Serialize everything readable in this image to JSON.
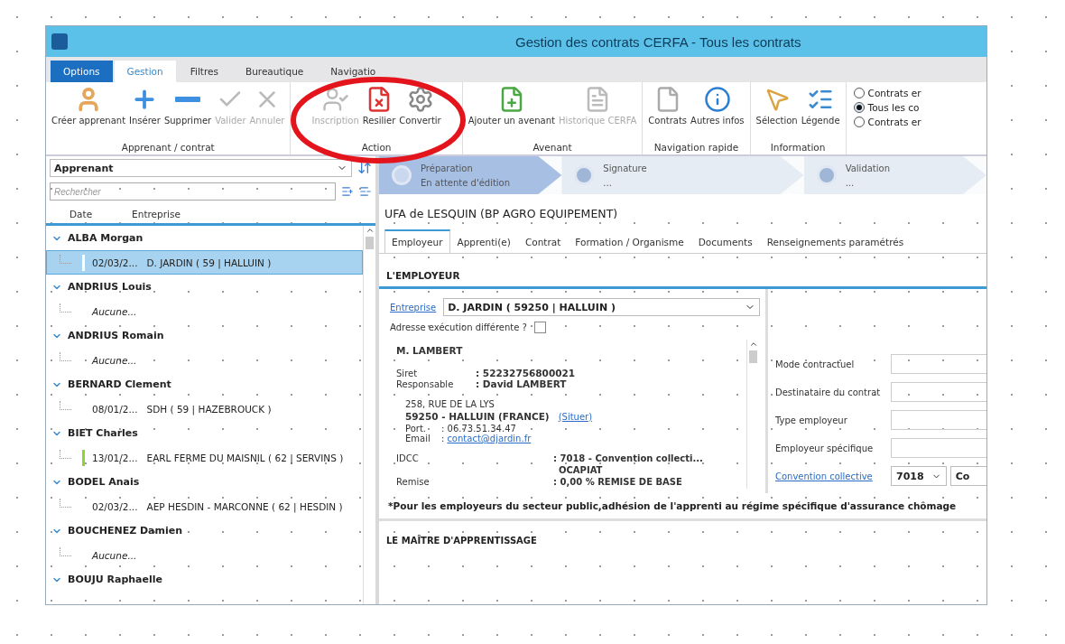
{
  "window": {
    "title": "Gestion des contrats CERFA - Tous les contrats"
  },
  "ribbon_tabs": [
    {
      "label": "Options",
      "kind": "menu",
      "selected": false
    },
    {
      "label": "Gestion",
      "kind": "tab",
      "selected": true
    },
    {
      "label": "Filtres",
      "kind": "tab",
      "selected": false
    },
    {
      "label": "Bureautique",
      "kind": "tab",
      "selected": false
    },
    {
      "label": "Navigatio",
      "kind": "tab",
      "selected": false
    }
  ],
  "ribbon": {
    "groups": [
      {
        "label": "Apprenant / contrat",
        "buttons": [
          {
            "label": "Créer apprenant",
            "disabled": false
          },
          {
            "label": "Insérer",
            "disabled": false
          },
          {
            "label": "Supprimer",
            "disabled": false
          },
          {
            "label": "Valider",
            "disabled": true
          },
          {
            "label": "Annuler",
            "disabled": true
          }
        ]
      },
      {
        "label": "Action",
        "buttons": [
          {
            "label": "Inscription",
            "disabled": true
          },
          {
            "label": "Resilier",
            "disabled": false
          },
          {
            "label": "Convertir",
            "disabled": false
          }
        ]
      },
      {
        "label": "Avenant",
        "buttons": [
          {
            "label": "Ajouter un avenant",
            "disabled": false
          },
          {
            "label": "Historique CERFA",
            "disabled": true
          }
        ]
      },
      {
        "label": "Navigation rapide",
        "buttons": [
          {
            "label": "Contrats",
            "disabled": false
          },
          {
            "label": "Autres infos",
            "disabled": false
          }
        ]
      },
      {
        "label": "Information",
        "buttons": [
          {
            "label": "Sélection",
            "disabled": false
          },
          {
            "label": "Légende",
            "disabled": false
          }
        ]
      }
    ],
    "filters": [
      {
        "label": "Contrats er",
        "selected": false
      },
      {
        "label": "Tous les co",
        "selected": true
      },
      {
        "label": "Contrats er",
        "selected": false
      }
    ]
  },
  "left_panel": {
    "group_by": "Apprenant",
    "search": {
      "placeholder": "Rechercher"
    },
    "columns": [
      "Date",
      "Entreprise"
    ],
    "groups": [
      {
        "name": "ALBA Morgan",
        "expanded": true,
        "children": [
          {
            "kind": "contract",
            "date": "02/03/2...",
            "company": "D. JARDIN ( 59 | HALLUIN )",
            "selected": true,
            "color": "#ffffff"
          }
        ]
      },
      {
        "name": "ANDRIUS Louis",
        "expanded": true,
        "children": [
          {
            "kind": "none",
            "text": "Aucune...",
            "selected": false
          }
        ]
      },
      {
        "name": "ANDRIUS Romain",
        "expanded": true,
        "children": [
          {
            "kind": "none",
            "text": "Aucune...",
            "selected": false
          }
        ]
      },
      {
        "name": "BERNARD Clement",
        "expanded": true,
        "children": [
          {
            "kind": "contract",
            "date": "08/01/2...",
            "company": "SDH ( 59 | HAZEBROUCK )",
            "selected": false
          }
        ]
      },
      {
        "name": "BIET Charles",
        "expanded": true,
        "children": [
          {
            "kind": "contract",
            "date": "13/01/2...",
            "company": "EARL FERME DU MAISNIL ( 62 | SERVINS )",
            "selected": false,
            "color": "#8fd62e"
          }
        ]
      },
      {
        "name": "BODEL Anais",
        "expanded": true,
        "children": [
          {
            "kind": "contract",
            "date": "02/03/2...",
            "company": "AEP HESDIN - MARCONNE ( 62 | HESDIN )",
            "selected": false
          }
        ]
      },
      {
        "name": "BOUCHENEZ Damien",
        "expanded": true,
        "children": [
          {
            "kind": "none",
            "text": "Aucune...",
            "selected": false
          }
        ]
      },
      {
        "name": "BOUJU Raphaelle",
        "expanded": true
      }
    ]
  },
  "steps": [
    {
      "title": "Préparation",
      "subtitle": "En attente d'édition",
      "active": true
    },
    {
      "title": "Signature",
      "subtitle": "...",
      "active": false
    },
    {
      "title": "Validation",
      "subtitle": "...",
      "active": false
    }
  ],
  "heading": "UFA de LESQUIN (BP AGRO EQUIPEMENT)",
  "detail_tabs": [
    {
      "label": "Employeur",
      "selected": true
    },
    {
      "label": "Apprenti(e)",
      "selected": false
    },
    {
      "label": "Contrat",
      "selected": false
    },
    {
      "label": "Formation / Organisme",
      "selected": false
    },
    {
      "label": "Documents",
      "selected": false
    },
    {
      "label": "Renseignements paramétrés",
      "selected": false
    }
  ],
  "employer": {
    "section_title": "L'EMPLOYEUR",
    "company_link": "Entreprise",
    "company_value": "D. JARDIN ( 59250 | HALLUIN )",
    "different_address": {
      "label": "Adresse exécution différente ?",
      "checked": false
    },
    "card": {
      "name": "M. LAMBERT",
      "siret_label": "Siret",
      "siret": ": 52232756800021",
      "manager_label": "Responsable",
      "manager": ": David LAMBERT",
      "street": "258, RUE DE LA LYS",
      "city": "59250 - HALLUIN (FRANCE)",
      "locate_link": "(Situer)",
      "phone_label": "Port.",
      "phone": ": 06.73.51.34.47",
      "email_label": "Email",
      "email_colon": ":",
      "email": "contact@djardin.fr",
      "idcc_label": "IDCC",
      "idcc": ": 7018 - Convention collecti...",
      "opco": "OCAPIAT",
      "discount_label": "Remise",
      "discount": ": 0,00 % REMISE DE BASE"
    },
    "fields": [
      {
        "label": "Mode contractuel"
      },
      {
        "label": "Destinataire du contrat"
      },
      {
        "label": "Type employeur"
      },
      {
        "label": "Employeur spécifique"
      }
    ],
    "convention": {
      "link": "Convention collective",
      "code": "7018",
      "name": "Co"
    },
    "note": "*Pour les employeurs du secteur public,adhésion de l'apprenti au régime spécifique d'assurance chômage"
  },
  "next_section_title": "LE MAÎTRE D'APPRENTISSAGE"
}
